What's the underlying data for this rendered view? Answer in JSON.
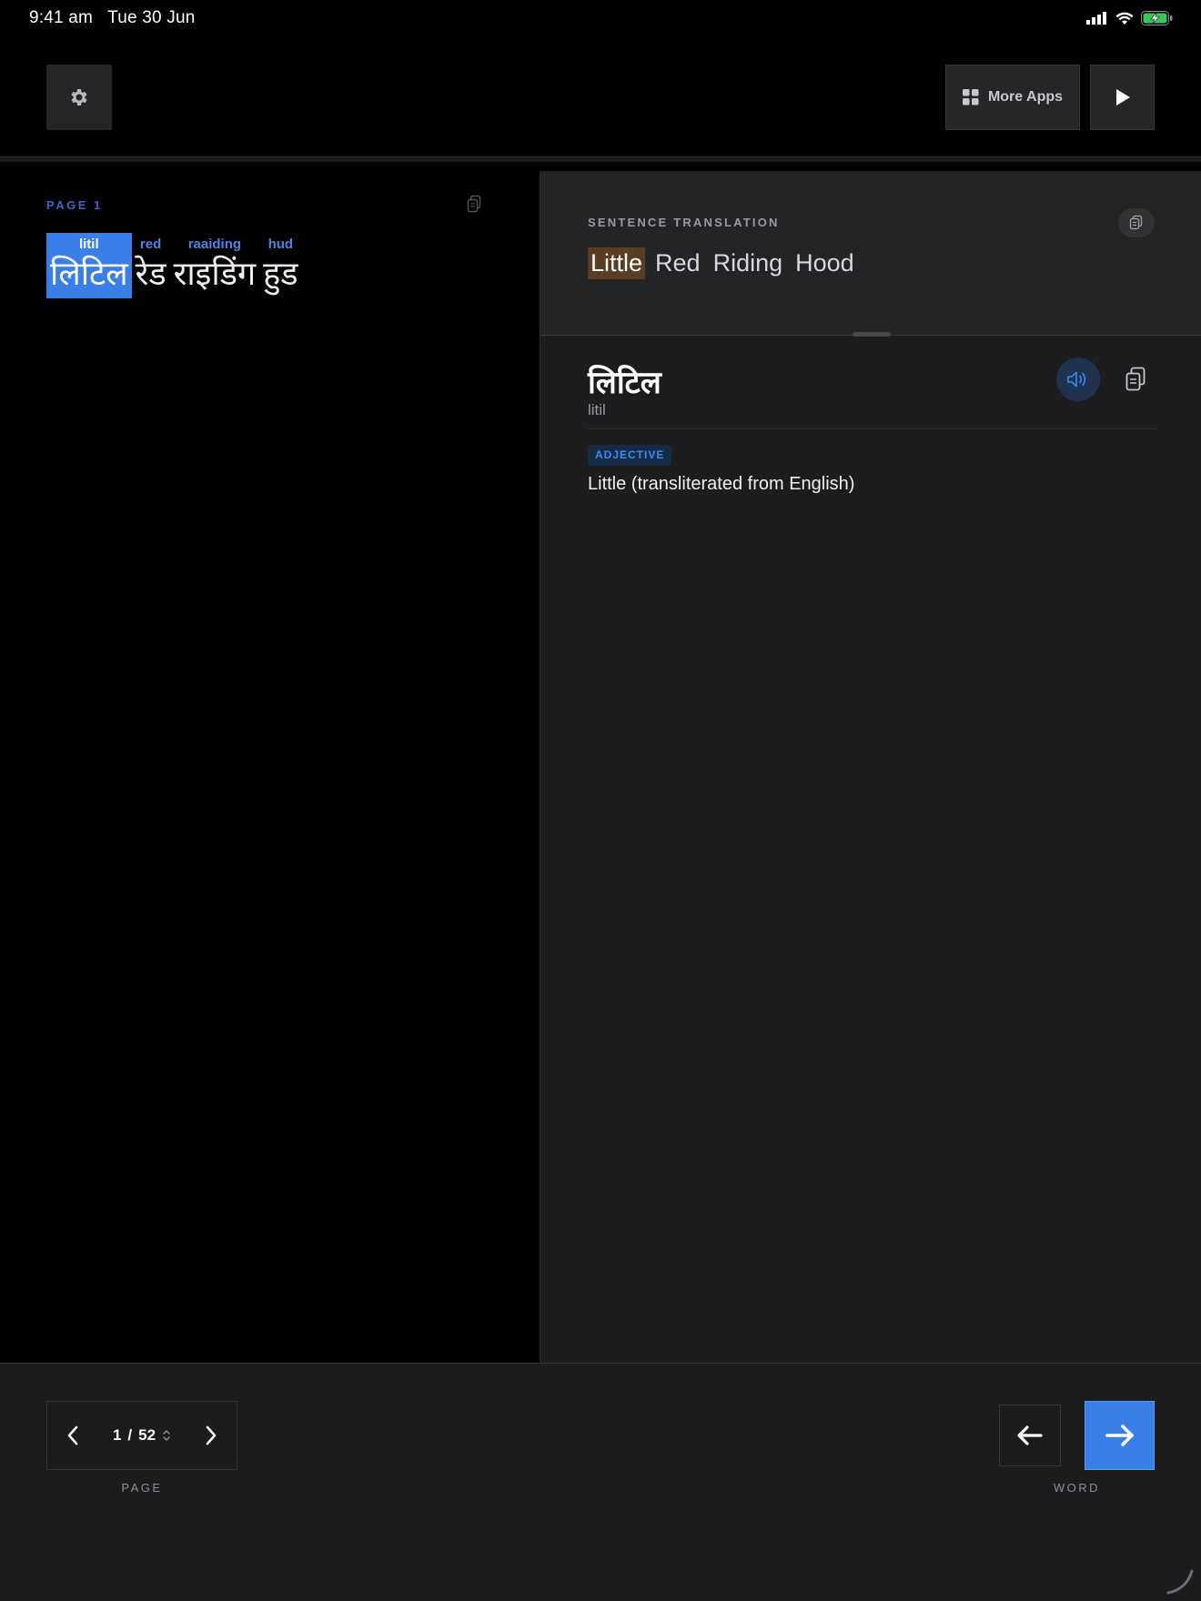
{
  "status_bar": {
    "time": "9:41 am",
    "date": "Tue 30 Jun",
    "icons": [
      "cellular-signal-icon",
      "wifi-icon",
      "battery-charging-icon"
    ]
  },
  "toolbar": {
    "settings_icon": "gear-icon",
    "more_apps_label": "More Apps",
    "more_apps_icon": "grid-icon",
    "play_icon": "play-icon"
  },
  "reader": {
    "page_label": "PAGE 1",
    "copy_icon": "copy-icon",
    "words": [
      {
        "translit": "litil",
        "text": "लिटिल",
        "selected": true
      },
      {
        "translit": "red",
        "text": "रेड",
        "selected": false
      },
      {
        "translit": "raaiding",
        "text": "राइडिंग",
        "selected": false
      },
      {
        "translit": "hud",
        "text": "हुड",
        "selected": false
      }
    ]
  },
  "translation": {
    "heading": "SENTENCE TRANSLATION",
    "words": [
      "Little",
      "Red",
      "Riding",
      "Hood"
    ],
    "highlighted_index": 0,
    "highlight_color": "#5a3d22"
  },
  "word_detail": {
    "word": "लिटिल",
    "translit": "litil",
    "part_of_speech": "ADJECTIVE",
    "definition": "Little (transliterated from English)",
    "audio_icon": "speaker-icon",
    "copy_icon": "copy-icon"
  },
  "navigation": {
    "current_page": "1",
    "separator": "/",
    "total_pages": "52",
    "page_caption": "PAGE",
    "word_caption": "WORD",
    "accent_color": "#3a7ee8"
  }
}
